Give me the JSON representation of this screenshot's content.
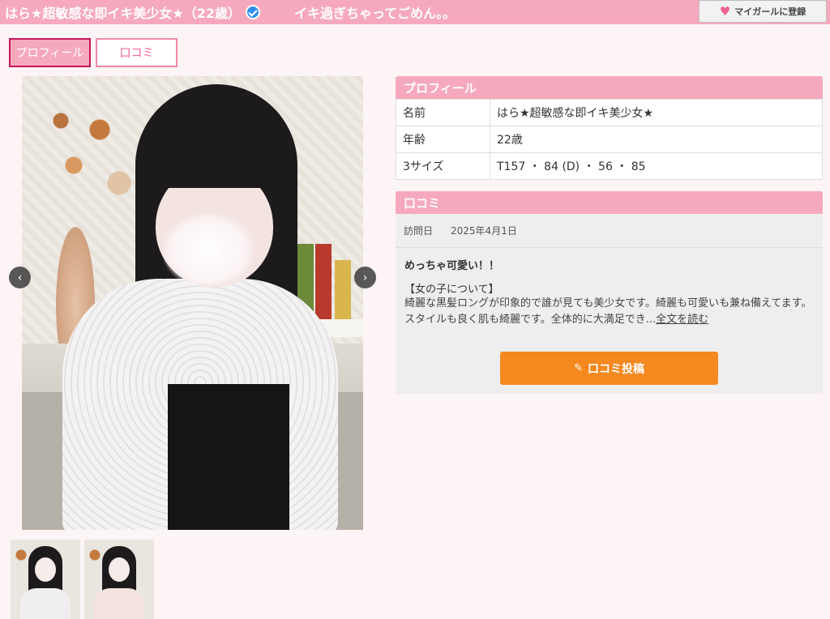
{
  "header": {
    "title": "はら★超敏感な即イキ美少女★（22歳）",
    "catchphrase": "イキ過ぎちゃってごめん。。",
    "favorite_button": "マイガールに登録",
    "favorite_icon": "heart-icon",
    "verified_icon": "verified-check-icon"
  },
  "tabs": [
    {
      "label": "プロフィール",
      "active": true
    },
    {
      "label": "口コミ",
      "active": false
    }
  ],
  "gallery": {
    "prev_icon": "chevron-left-icon",
    "next_icon": "chevron-right-icon",
    "prev_glyph": "‹",
    "next_glyph": "›",
    "thumbnail_count": 2
  },
  "profile": {
    "header": "プロフィール",
    "rows": [
      {
        "key": "名前",
        "value": "はら★超敏感な即イキ美少女★"
      },
      {
        "key": "年齢",
        "value": "22歳"
      },
      {
        "key": "3サイズ",
        "value": "T157 ・ 84 (D) ・ 56 ・ 85"
      }
    ]
  },
  "review": {
    "header": "口コミ",
    "visit_label": "訪問日",
    "visit_date": "2025年4月1日",
    "title": "めっちゃ可愛い！！",
    "subheading": "【女の子について】",
    "body": "綺麗な黒髪ロングが印象的で誰が見ても美少女です。綺麗も可愛いも兼ね備えてます。スタイルも良く肌も綺麗です。全体的に大満足でき...",
    "read_more": "全文を読む",
    "post_button": "口コミ投稿",
    "post_icon": "pen-icon"
  },
  "colors": {
    "accent_pink": "#f6a9bd",
    "button_orange": "#f5891f",
    "verified_blue": "#2f8ff0"
  }
}
